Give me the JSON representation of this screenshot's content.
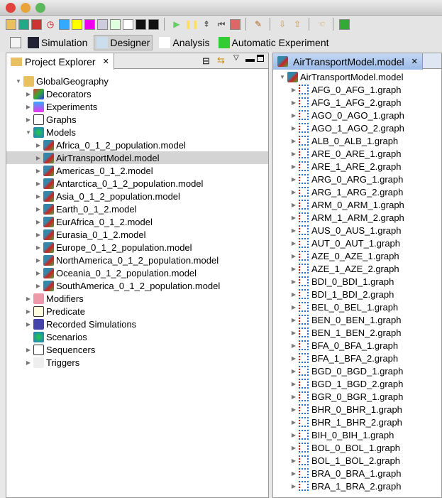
{
  "window": {
    "traffic_lights": [
      "#e0443e",
      "#e8a33a",
      "#5cb85c"
    ]
  },
  "toolbar": {
    "icons": [
      "open-folder-icon",
      "globe-icon",
      "model-icon",
      "clock-icon",
      "flask-icon",
      "switch-icon",
      "predicate-icon",
      "person-icon",
      "person-infected-icon",
      "graph-icon",
      "trigger-icon",
      "trigger-info-icon",
      "play-icon",
      "pause-icon",
      "step-icon",
      "reset-icon",
      "stop-icon",
      "brush-icon",
      "import-icon",
      "export-icon",
      "back-icon",
      "run-menu-icon"
    ]
  },
  "perspectives": [
    {
      "label": "Simulation",
      "icon": "stem-logo-icon",
      "active": false
    },
    {
      "label": "Designer",
      "icon": "stem-designer-icon",
      "active": true
    },
    {
      "label": "Analysis",
      "icon": "microscope-icon",
      "active": false
    },
    {
      "label": "Automatic Experiment",
      "icon": "experiment-flask-icon",
      "active": false
    }
  ],
  "project_explorer": {
    "title": "Project Explorer",
    "tree": [
      {
        "label": "GlobalGeography",
        "level": 0,
        "expanded": true,
        "icon": "folder"
      },
      {
        "label": "Decorators",
        "level": 1,
        "expanded": false,
        "icon": "decorator"
      },
      {
        "label": "Experiments",
        "level": 1,
        "expanded": false,
        "icon": "experiment"
      },
      {
        "label": "Graphs",
        "level": 1,
        "expanded": false,
        "icon": "graph"
      },
      {
        "label": "Models",
        "level": 1,
        "expanded": true,
        "icon": "globe"
      },
      {
        "label": "Africa_0_1_2_population.model",
        "level": 2,
        "expanded": false,
        "icon": "model"
      },
      {
        "label": "AirTransportModel.model",
        "level": 2,
        "expanded": false,
        "icon": "model",
        "selected": true
      },
      {
        "label": "Americas_0_1_2.model",
        "level": 2,
        "expanded": false,
        "icon": "model"
      },
      {
        "label": "Antarctica_0_1_2_population.model",
        "level": 2,
        "expanded": false,
        "icon": "model"
      },
      {
        "label": "Asia_0_1_2_population.model",
        "level": 2,
        "expanded": false,
        "icon": "model"
      },
      {
        "label": "Earth_0_1_2.model",
        "level": 2,
        "expanded": false,
        "icon": "model"
      },
      {
        "label": "EurAfrica_0_1_2.model",
        "level": 2,
        "expanded": false,
        "icon": "model"
      },
      {
        "label": "Eurasia_0_1_2.model",
        "level": 2,
        "expanded": false,
        "icon": "model"
      },
      {
        "label": "Europe_0_1_2_population.model",
        "level": 2,
        "expanded": false,
        "icon": "model"
      },
      {
        "label": "NorthAmerica_0_1_2_population.model",
        "level": 2,
        "expanded": false,
        "icon": "model"
      },
      {
        "label": "Oceania_0_1_2_population.model",
        "level": 2,
        "expanded": false,
        "icon": "model"
      },
      {
        "label": "SouthAmerica_0_1_2_population.model",
        "level": 2,
        "expanded": false,
        "icon": "model"
      },
      {
        "label": "Modifiers",
        "level": 1,
        "expanded": false,
        "icon": "modifier"
      },
      {
        "label": "Predicate",
        "level": 1,
        "expanded": false,
        "icon": "predicate"
      },
      {
        "label": "Recorded Simulations",
        "level": 1,
        "expanded": false,
        "icon": "recorded"
      },
      {
        "label": "Scenarios",
        "level": 1,
        "leaf": true,
        "icon": "globe"
      },
      {
        "label": "Sequencers",
        "level": 1,
        "expanded": false,
        "icon": "clock"
      },
      {
        "label": "Triggers",
        "level": 1,
        "expanded": false,
        "icon": "trigger"
      }
    ]
  },
  "editor": {
    "tab": "AirTransportModel.model",
    "root": "AirTransportModel.model",
    "items": [
      "AFG_0_AFG_1.graph",
      "AFG_1_AFG_2.graph",
      "AGO_0_AGO_1.graph",
      "AGO_1_AGO_2.graph",
      "ALB_0_ALB_1.graph",
      "ARE_0_ARE_1.graph",
      "ARE_1_ARE_2.graph",
      "ARG_0_ARG_1.graph",
      "ARG_1_ARG_2.graph",
      "ARM_0_ARM_1.graph",
      "ARM_1_ARM_2.graph",
      "AUS_0_AUS_1.graph",
      "AUT_0_AUT_1.graph",
      "AZE_0_AZE_1.graph",
      "AZE_1_AZE_2.graph",
      "BDI_0_BDI_1.graph",
      "BDI_1_BDI_2.graph",
      "BEL_0_BEL_1.graph",
      "BEN_0_BEN_1.graph",
      "BEN_1_BEN_2.graph",
      "BFA_0_BFA_1.graph",
      "BFA_1_BFA_2.graph",
      "BGD_0_BGD_1.graph",
      "BGD_1_BGD_2.graph",
      "BGR_0_BGR_1.graph",
      "BHR_0_BHR_1.graph",
      "BHR_1_BHR_2.graph",
      "BIH_0_BIH_1.graph",
      "BOL_0_BOL_1.graph",
      "BOL_1_BOL_2.graph",
      "BRA_0_BRA_1.graph",
      "BRA_1_BRA_2.graph"
    ]
  }
}
